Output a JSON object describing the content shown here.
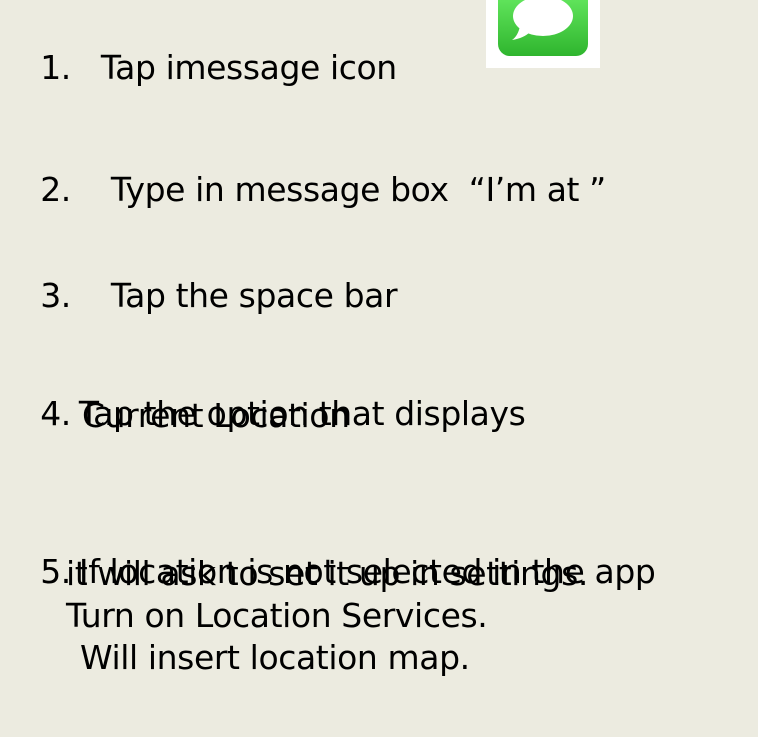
{
  "steps": [
    {
      "num": "1.",
      "text": "Tap imessage icon"
    },
    {
      "num": "2.",
      "text": "Type in message box  “I’m at ”"
    },
    {
      "num": "3.",
      "text": "Tap the space bar"
    },
    {
      "num": "4.",
      "text": "Tap the option that displays",
      "cont": [
        "Current Location"
      ]
    },
    {
      "num": "5.",
      "text": "If location is not selected in the app",
      "cont": [
        "it will ask to set it up in settings.",
        "Turn on Location Services.",
        "Will insert location map."
      ]
    }
  ],
  "icon": {
    "name": "messages-app-icon",
    "color": "#3cc83a"
  }
}
